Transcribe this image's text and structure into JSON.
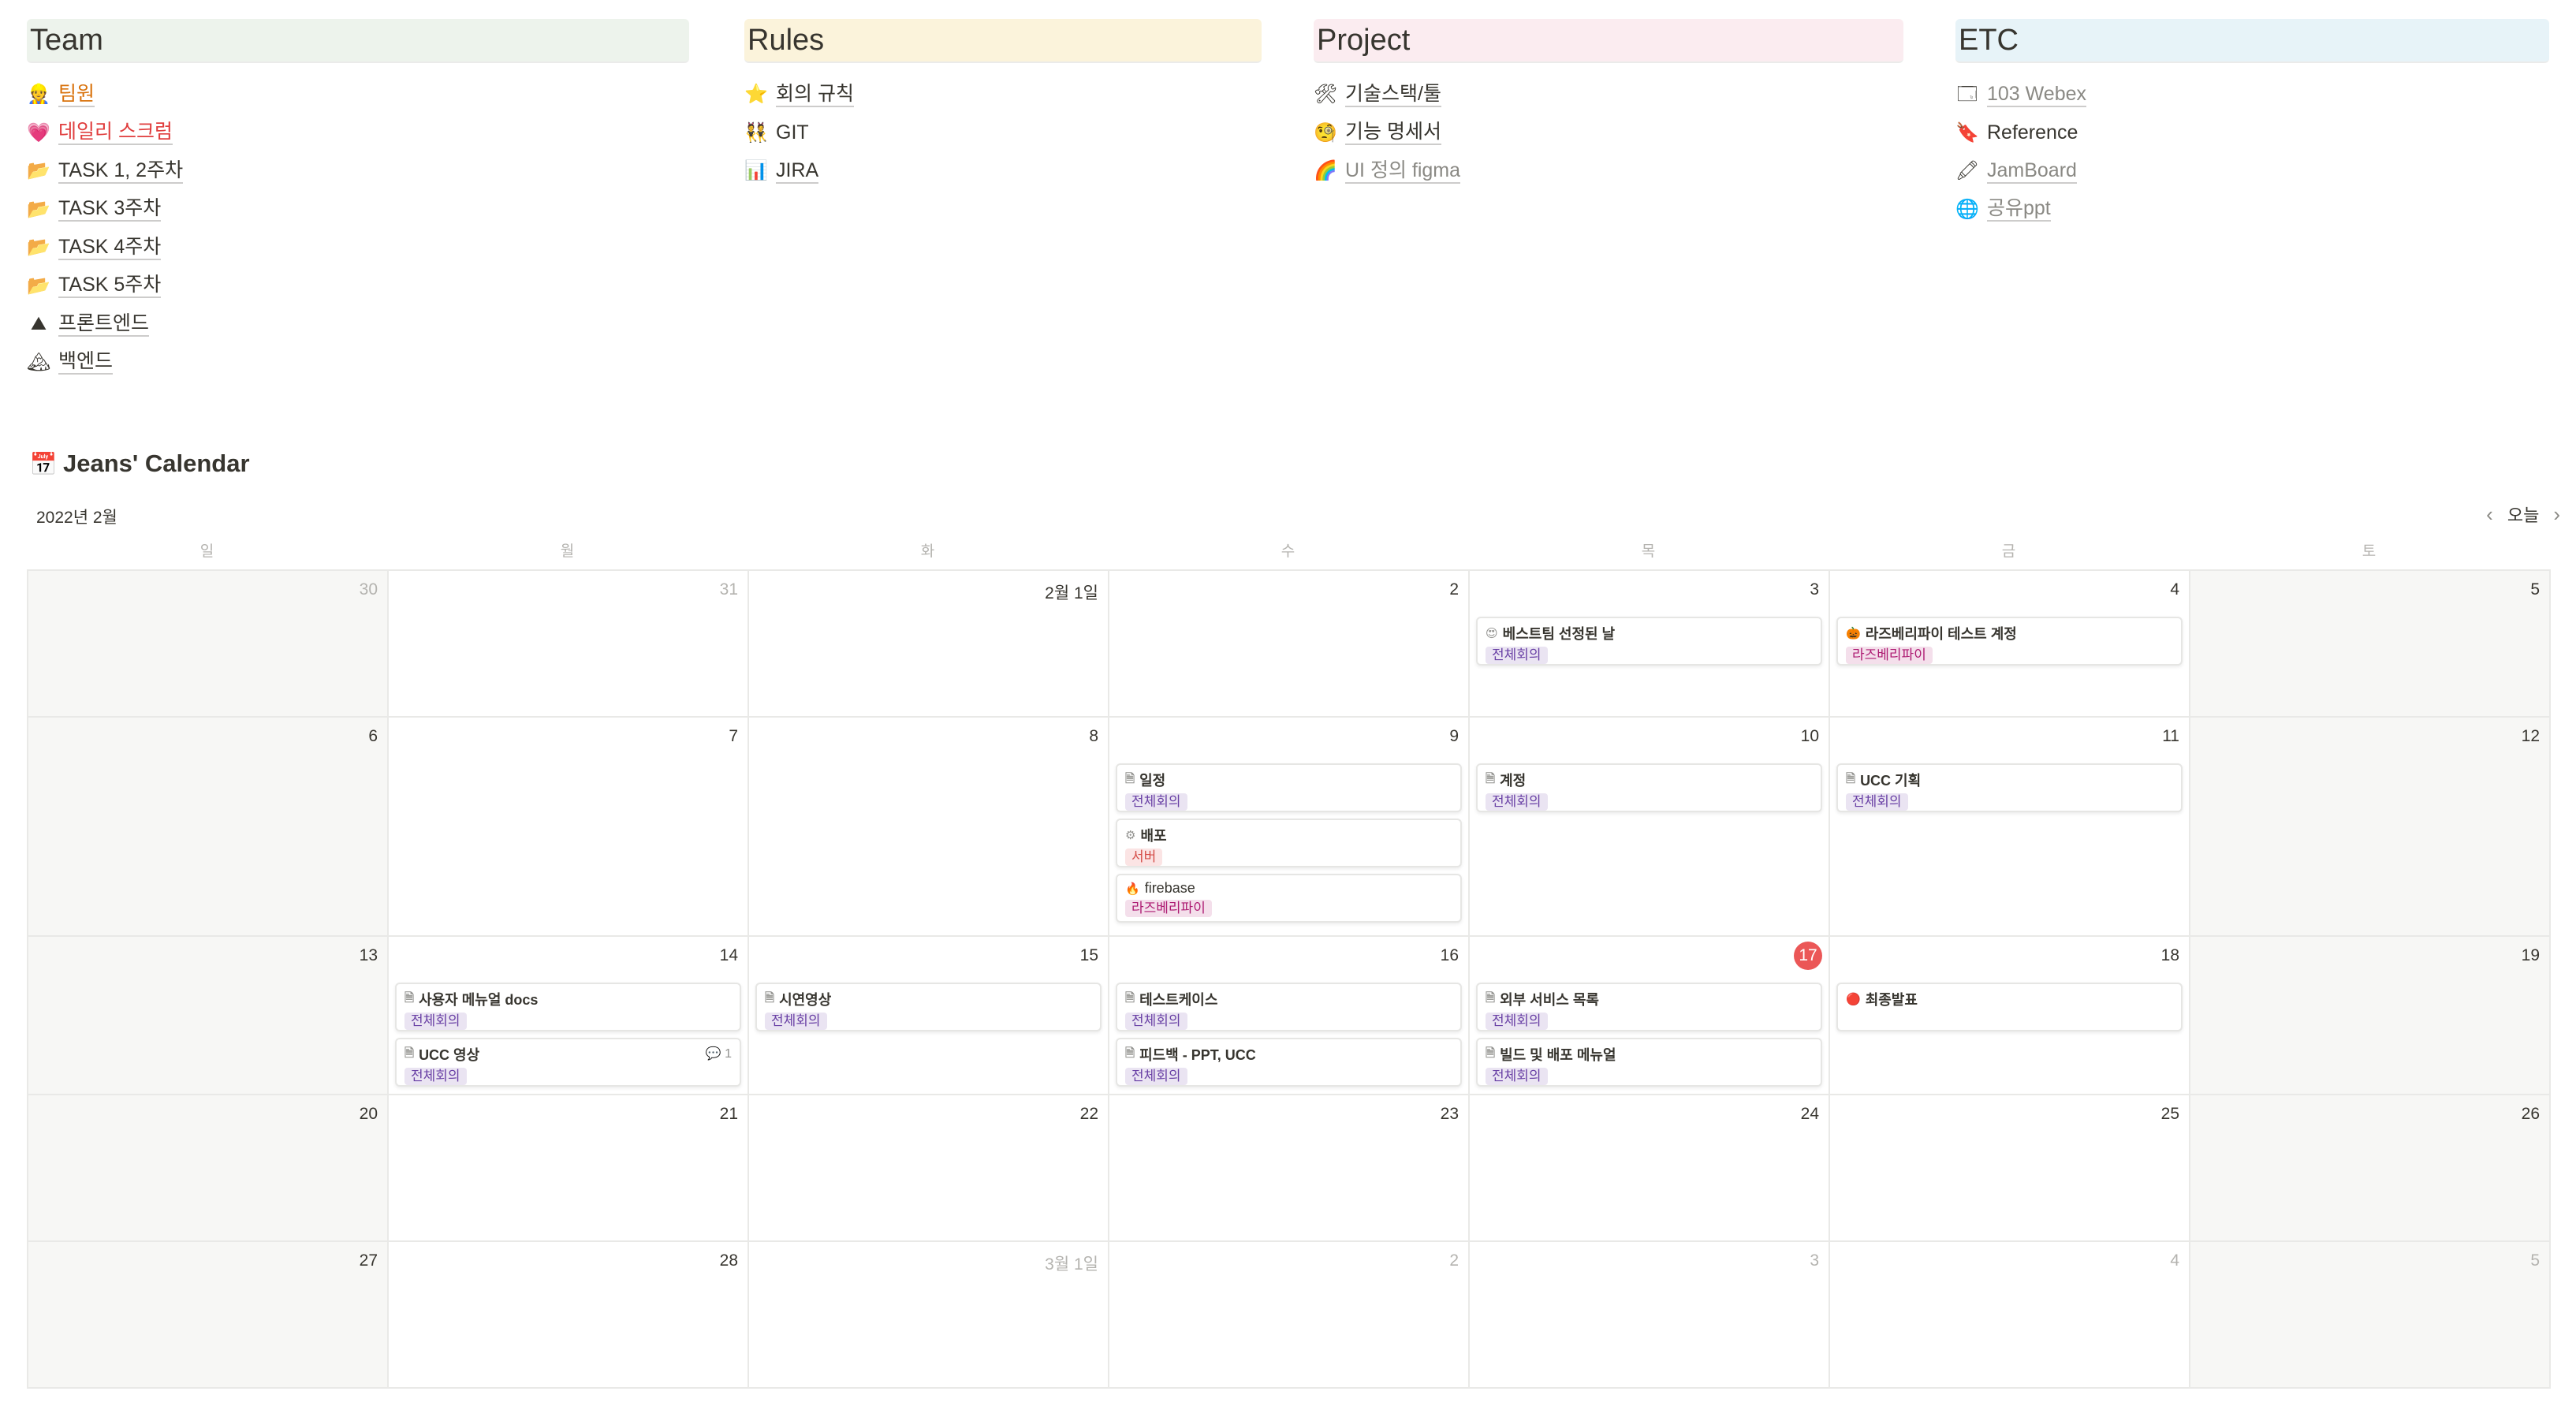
{
  "columns": [
    {
      "key": "team",
      "title": "Team",
      "bg": "#edf3ec",
      "items": [
        {
          "label": "팀원",
          "icon": "👷",
          "icon_name": "worker-icon",
          "color": "orange"
        },
        {
          "label": "데일리 스크럼",
          "icon": "💗",
          "icon_name": "heart-icon",
          "color": "red"
        },
        {
          "label": "TASK 1, 2주차",
          "icon": "📂",
          "icon_name": "folder-icon"
        },
        {
          "label": "TASK 3주차",
          "icon": "📂",
          "icon_name": "folder-icon"
        },
        {
          "label": "TASK 4주차",
          "icon": "📂",
          "icon_name": "folder-icon"
        },
        {
          "label": "TASK 5주차",
          "icon": "📂",
          "icon_name": "folder-icon"
        },
        {
          "label": "프론트엔드",
          "icon": "⛰",
          "icon_name": "mountain-icon"
        },
        {
          "label": "백엔드",
          "icon": "🏔",
          "icon_name": "snow-mountain-icon"
        }
      ]
    },
    {
      "key": "rules",
      "title": "Rules",
      "bg": "#fbf3db",
      "items": [
        {
          "label": "회의 규칙",
          "icon": "⭐",
          "icon_name": "star-icon"
        },
        {
          "label": "GIT",
          "icon": "👯",
          "icon_name": "people-icon",
          "plain": true
        },
        {
          "label": "JIRA",
          "icon": "📊",
          "icon_name": "chart-icon"
        }
      ]
    },
    {
      "key": "project",
      "title": "Project",
      "bg": "#fbecf0",
      "items": [
        {
          "label": "기술스택/툴",
          "icon": "🛠",
          "icon_name": "tools-icon"
        },
        {
          "label": "기능 명세서",
          "icon": "🧐",
          "icon_name": "monocle-face-icon"
        },
        {
          "label": "UI 정의 figma",
          "icon": "🌈",
          "icon_name": "rainbow-icon",
          "color": "gray"
        }
      ]
    },
    {
      "key": "etc",
      "title": "ETC",
      "bg": "#e7f3f8",
      "items": [
        {
          "label": "103 Webex",
          "icon": "🗔",
          "icon_name": "window-icon",
          "color": "gray"
        },
        {
          "label": "Reference",
          "icon": "🔖",
          "icon_name": "bookmark-icon",
          "plain": true
        },
        {
          "label": "JamBoard",
          "icon": "🖍",
          "icon_name": "crayon-icon",
          "color": "gray"
        },
        {
          "label": "공유ppt",
          "icon": "🌐",
          "icon_name": "globe-icon",
          "color": "gray"
        }
      ]
    }
  ],
  "calendar": {
    "title": "Jeans' Calendar",
    "icon": "📅",
    "month": "2022년 2월",
    "today_label": "오늘",
    "weekdays": [
      "일",
      "월",
      "화",
      "수",
      "목",
      "금",
      "토"
    ],
    "weeks": [
      [
        {
          "day": "30",
          "muted": true
        },
        {
          "day": "31",
          "muted": true
        },
        {
          "day": "2월 1일"
        },
        {
          "day": "2"
        },
        {
          "day": "3",
          "events": [
            {
              "title": "베스트팀 선정된 날",
              "icon": "😍",
              "tag": "전체회의",
              "tag_color": "purple"
            }
          ]
        },
        {
          "day": "4",
          "events": [
            {
              "title": "라즈베리파이 테스트 계정",
              "icon": "🎃",
              "tag": "라즈베리파이",
              "tag_color": "pink"
            }
          ]
        },
        {
          "day": "5"
        }
      ],
      [
        {
          "day": "6"
        },
        {
          "day": "7"
        },
        {
          "day": "8"
        },
        {
          "day": "9",
          "events": [
            {
              "title": "일정",
              "icon": "🗎",
              "tag": "전체회의",
              "tag_color": "purple"
            },
            {
              "title": "배포",
              "icon": "⚙",
              "tag": "서버",
              "tag_color": "red"
            },
            {
              "title": "firebase",
              "icon": "🔥",
              "tag": "라즈베리파이",
              "tag_color": "pink",
              "light": true
            }
          ]
        },
        {
          "day": "10",
          "events": [
            {
              "title": "계정",
              "icon": "🗎",
              "tag": "전체회의",
              "tag_color": "purple"
            }
          ]
        },
        {
          "day": "11",
          "events": [
            {
              "title": "UCC 기획",
              "icon": "🗎",
              "tag": "전체회의",
              "tag_color": "purple"
            }
          ]
        },
        {
          "day": "12"
        }
      ],
      [
        {
          "day": "13"
        },
        {
          "day": "14",
          "events": [
            {
              "title": "사용자 메뉴얼 docs",
              "icon": "🗎",
              "tag": "전체회의",
              "tag_color": "purple"
            },
            {
              "title": "UCC 영상",
              "icon": "🗎",
              "tag": "전체회의",
              "tag_color": "purple",
              "comments": "1"
            }
          ]
        },
        {
          "day": "15",
          "events": [
            {
              "title": "시연영상",
              "icon": "🗎",
              "tag": "전체회의",
              "tag_color": "purple"
            }
          ]
        },
        {
          "day": "16",
          "events": [
            {
              "title": "테스트케이스",
              "icon": "🗎",
              "tag": "전체회의",
              "tag_color": "purple"
            },
            {
              "title": "피드백 - PPT, UCC",
              "icon": "🗎",
              "tag": "전체회의",
              "tag_color": "purple"
            }
          ]
        },
        {
          "day": "17",
          "today": true,
          "events": [
            {
              "title": "외부 서비스 목록",
              "icon": "🗎",
              "tag": "전체회의",
              "tag_color": "purple"
            },
            {
              "title": "빌드 및 배포 메뉴얼",
              "icon": "🗎",
              "tag": "전체회의",
              "tag_color": "purple"
            }
          ]
        },
        {
          "day": "18",
          "events": [
            {
              "title": "최종발표",
              "icon": "🔴",
              "tag": "",
              "tag_color": ""
            }
          ]
        },
        {
          "day": "19"
        }
      ],
      [
        {
          "day": "20"
        },
        {
          "day": "21"
        },
        {
          "day": "22"
        },
        {
          "day": "23"
        },
        {
          "day": "24"
        },
        {
          "day": "25"
        },
        {
          "day": "26"
        }
      ],
      [
        {
          "day": "27"
        },
        {
          "day": "28"
        },
        {
          "day": "3월 1일",
          "muted": true
        },
        {
          "day": "2",
          "muted": true
        },
        {
          "day": "3",
          "muted": true
        },
        {
          "day": "4",
          "muted": true
        },
        {
          "day": "5",
          "muted": true
        }
      ]
    ]
  }
}
